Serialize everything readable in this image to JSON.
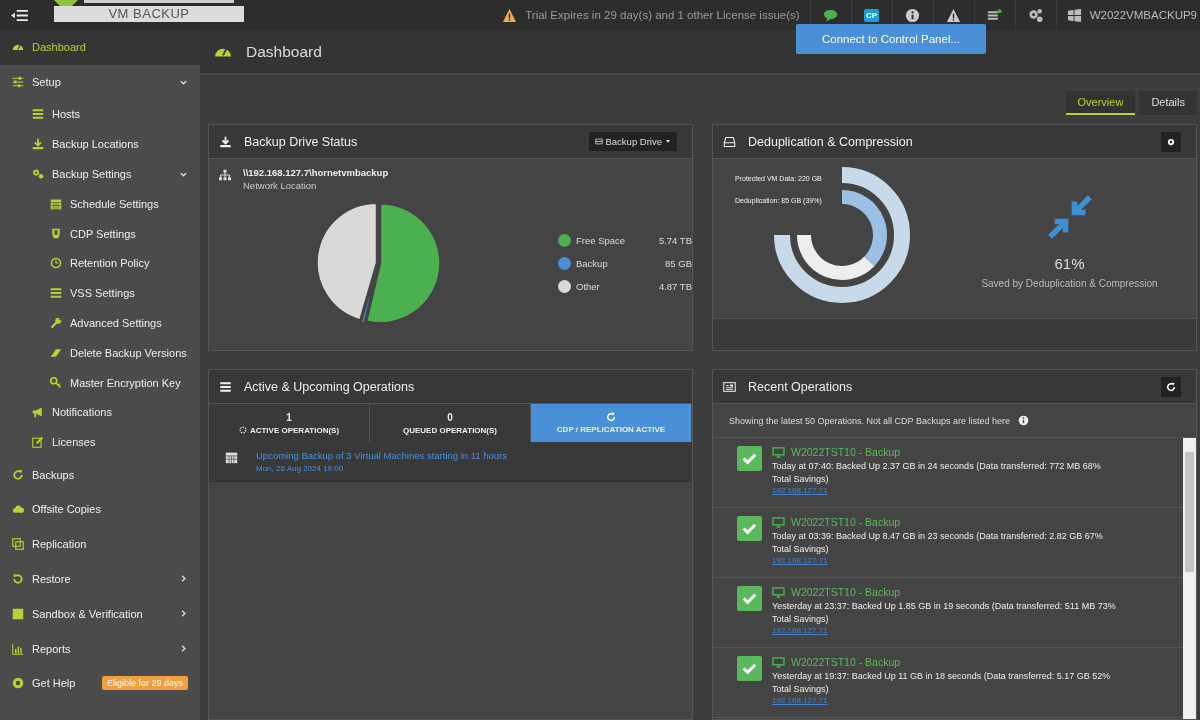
{
  "topbar": {
    "logo": "VM BACKUP",
    "license_warning": "Trial Expires in 29 day(s) and 1 other License issue(s)",
    "cp_badge": "CP",
    "hostname": "W2022VMBACKUP9",
    "tooltip": "Connect to Control Panel..."
  },
  "sidebar": {
    "items": [
      {
        "label": "Dashboard",
        "selected": true
      },
      {
        "label": "Setup",
        "selected": false,
        "expanded": true,
        "children": [
          {
            "label": "Hosts",
            "selected": false
          },
          {
            "label": "Backup Locations",
            "selected": false
          },
          {
            "label": "Backup Settings",
            "selected": false,
            "expanded": true,
            "children": [
              {
                "label": "Schedule Settings",
                "selected": false
              },
              {
                "label": "CDP Settings",
                "selected": false
              },
              {
                "label": "Retention Policy",
                "selected": false
              },
              {
                "label": "VSS Settings",
                "selected": false
              },
              {
                "label": "Advanced Settings",
                "selected": false
              },
              {
                "label": "Delete Backup Versions",
                "selected": false
              },
              {
                "label": "Master Encryption Key",
                "selected": false
              }
            ]
          },
          {
            "label": "Notifications",
            "selected": false
          },
          {
            "label": "Licenses",
            "selected": false
          }
        ]
      },
      {
        "label": "Backups",
        "selected": false
      },
      {
        "label": "Offsite Copies",
        "selected": false
      },
      {
        "label": "Replication",
        "selected": false
      },
      {
        "label": "Restore",
        "selected": false,
        "expanded": false
      },
      {
        "label": "Sandbox & Verification",
        "selected": false,
        "expanded": false
      },
      {
        "label": "Reports",
        "selected": false,
        "expanded": false
      },
      {
        "label": "Get Help",
        "selected": false,
        "badge": "Eligible for 29 days"
      }
    ]
  },
  "page": {
    "title": "Dashboard",
    "tabs": [
      {
        "label": "Overview",
        "selected": true
      },
      {
        "label": "Details",
        "selected": false
      }
    ]
  },
  "drive_status": {
    "title": "Backup Drive Status",
    "dropdown": "Backup Drive",
    "path": "\\\\192.168.127.7\\hornetvmbackup",
    "location_type": "Network Location",
    "chart_data": {
      "type": "pie",
      "categories": [
        "Free Space",
        "Backup",
        "Other"
      ],
      "values": [
        53.7,
        0.8,
        45.5
      ]
    },
    "legend": [
      {
        "value": "5.74 TB",
        "color": "#4caf50"
      },
      {
        "value": "85 GB",
        "color": "#4a90d9"
      },
      {
        "value": "4.87 TB",
        "color": "#d9d9d9"
      }
    ]
  },
  "dedup": {
    "title": "Deduplication & Compression",
    "protected_label": "Protected VM Data: 220 GB",
    "dedup_label": "Deduplication: 85 GB (39%)",
    "percent": "61%",
    "caption": "Saved by Deduplication & Compression"
  },
  "operations": {
    "title": "Active & Upcoming Operations",
    "stats": [
      {
        "kind": "count",
        "value": "1",
        "label": "ACTIVE OPERATION(S)",
        "selected": false
      },
      {
        "kind": "count",
        "value": "0",
        "label": "QUEUED OPERATION(S)",
        "selected": false
      },
      {
        "kind": "status",
        "label": "CDP / REPLICATION ACTIVE",
        "selected": true
      }
    ],
    "upcoming": [
      {
        "text": "Upcoming Backup of 3 Virtual Machines starting in 11 hours",
        "date": "Mon, 26 Aug 2024 19:00"
      }
    ]
  },
  "recent": {
    "title": "Recent Operations",
    "note": "Showing the latest 50 Operations. Not all CDP Backups are listed here",
    "items": [
      {
        "success": true,
        "title": "W2022TST10 - Backup",
        "detail": "Today at 07:40: Backed Up 2.37 GB in 24 seconds (Data transferred: 772 MB 68% Total Savings)",
        "ip": "192.168.127.71"
      },
      {
        "success": true,
        "title": "W2022TST10 - Backup",
        "detail": "Today at 03:39: Backed Up 8.47 GB in 23 seconds (Data transferred: 2.82 GB 67% Total Savings)",
        "ip": "192.168.127.71"
      },
      {
        "success": true,
        "title": "W2022TST10 - Backup",
        "detail": "Yesterday at 23:37: Backed Up 1.85 GB in 19 seconds (Data transferred: 511 MB 73% Total Savings)",
        "ip": "192.168.127.71"
      },
      {
        "success": true,
        "title": "W2022TST10 - Backup",
        "detail": "Yesterday at 19:37: Backed Up 11 GB in 18 seconds (Data transferred: 5.17 GB 52% Total Savings)",
        "ip": "192.168.127.71"
      }
    ]
  }
}
